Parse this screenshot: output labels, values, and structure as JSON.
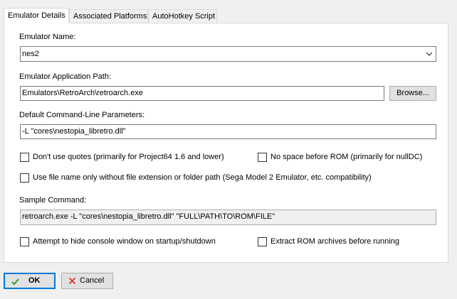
{
  "tabs": [
    {
      "label": "Emulator Details",
      "active": true
    },
    {
      "label": "Associated Platforms",
      "active": false
    },
    {
      "label": "AutoHotkey Script",
      "active": false
    }
  ],
  "emulator_name": {
    "label": "Emulator Name:",
    "value": "nes2"
  },
  "app_path": {
    "label": "Emulator Application Path:",
    "value": "Emulators\\RetroArch\\retroarch.exe",
    "browse_label": "Browse..."
  },
  "cmd_params": {
    "label": "Default Command-Line Parameters:",
    "value": "-L \"cores\\nestopia_libretro.dll\""
  },
  "options": {
    "dont_use_quotes": {
      "label": "Don't use quotes (primarily for Project64 1.6 and lower)",
      "checked": false
    },
    "no_space_before_rom": {
      "label": "No space before ROM (primarily for nullDC)",
      "checked": false
    },
    "file_name_only": {
      "label": "Use file name only without file extension or folder path (Sega Model 2 Emulator, etc. compatibility)",
      "checked": false
    },
    "hide_console": {
      "label": "Attempt to hide console window on startup/shutdown",
      "checked": false
    },
    "extract_rom": {
      "label": "Extract ROM archives before running",
      "checked": false
    }
  },
  "sample_command": {
    "label": "Sample Command:",
    "value": "retroarch.exe -L \"cores\\nestopia_libretro.dll\" \"FULL\\PATH\\TO\\ROM\\FILE\""
  },
  "footer": {
    "ok_label": "OK",
    "cancel_label": "Cancel"
  },
  "colors": {
    "accent": "#0078d7",
    "ok_check": "#2e9e2e",
    "cancel_x": "#d9352b"
  },
  "icons": {
    "ok": "check-icon",
    "cancel": "x-icon",
    "dropdown": "chevron-down-icon"
  }
}
